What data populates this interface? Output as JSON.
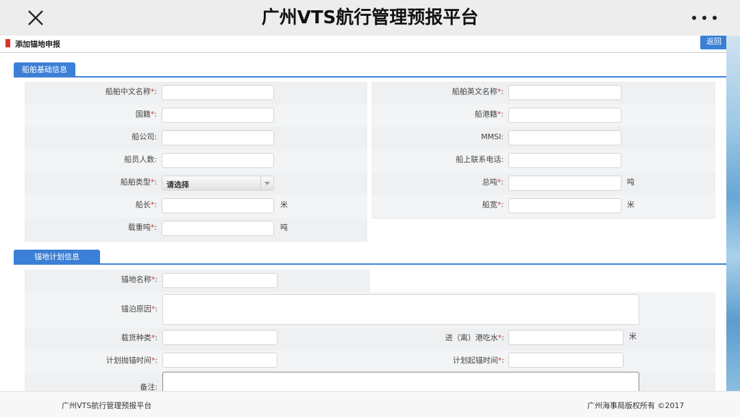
{
  "window": {
    "title": "广州VTS航行管理预报平台"
  },
  "breadcrumb": {
    "current": "添加锚地申报"
  },
  "actions": {
    "back_label": "返回"
  },
  "sections": {
    "vessel": "船舶基础信息",
    "anchorage": "锚地计划信息"
  },
  "vessel_form": {
    "cn_name_label": "船舶中文名称",
    "en_name_label": "船舶英文名称",
    "nationality_label": "国籍",
    "port_registry_label": "船港籍",
    "company_label": "船公司",
    "mmsi_label": "MMSI",
    "crew_count_label": "船员人数",
    "ship_phone_label": "船上联系电话",
    "ship_type_label": "船舶类型",
    "ship_type_value": "请选择",
    "gross_tonnage_label": "总吨",
    "gross_tonnage_unit": "吨",
    "length_label": "船长",
    "length_unit": "米",
    "width_label": "船宽",
    "width_unit": "米",
    "dwt_label": "载重吨",
    "dwt_unit": "吨"
  },
  "anchorage_form": {
    "name_label": "锚地名称",
    "reason_label": "锚泊原因",
    "cargo_label": "载货种类",
    "draft_label": "进（离）港吃水",
    "draft_unit": "米",
    "drop_time_label": "计划抛锚时间",
    "lift_time_label": "计划起锚时间",
    "remarks_label": "备注"
  },
  "common": {
    "required_mark": "*",
    "colon": ":"
  },
  "footer": {
    "left": "广州VTS航行管理预报平台",
    "right": "广州海事局版权所有 ©2017"
  },
  "colors": {
    "accent": "#3b7fd6",
    "required": "#e0322a",
    "breadcrumb_marker": "#d9342b"
  },
  "icons": {
    "close": "close-icon",
    "more": "more-dots-icon",
    "dropdown": "chevron-down-icon"
  }
}
